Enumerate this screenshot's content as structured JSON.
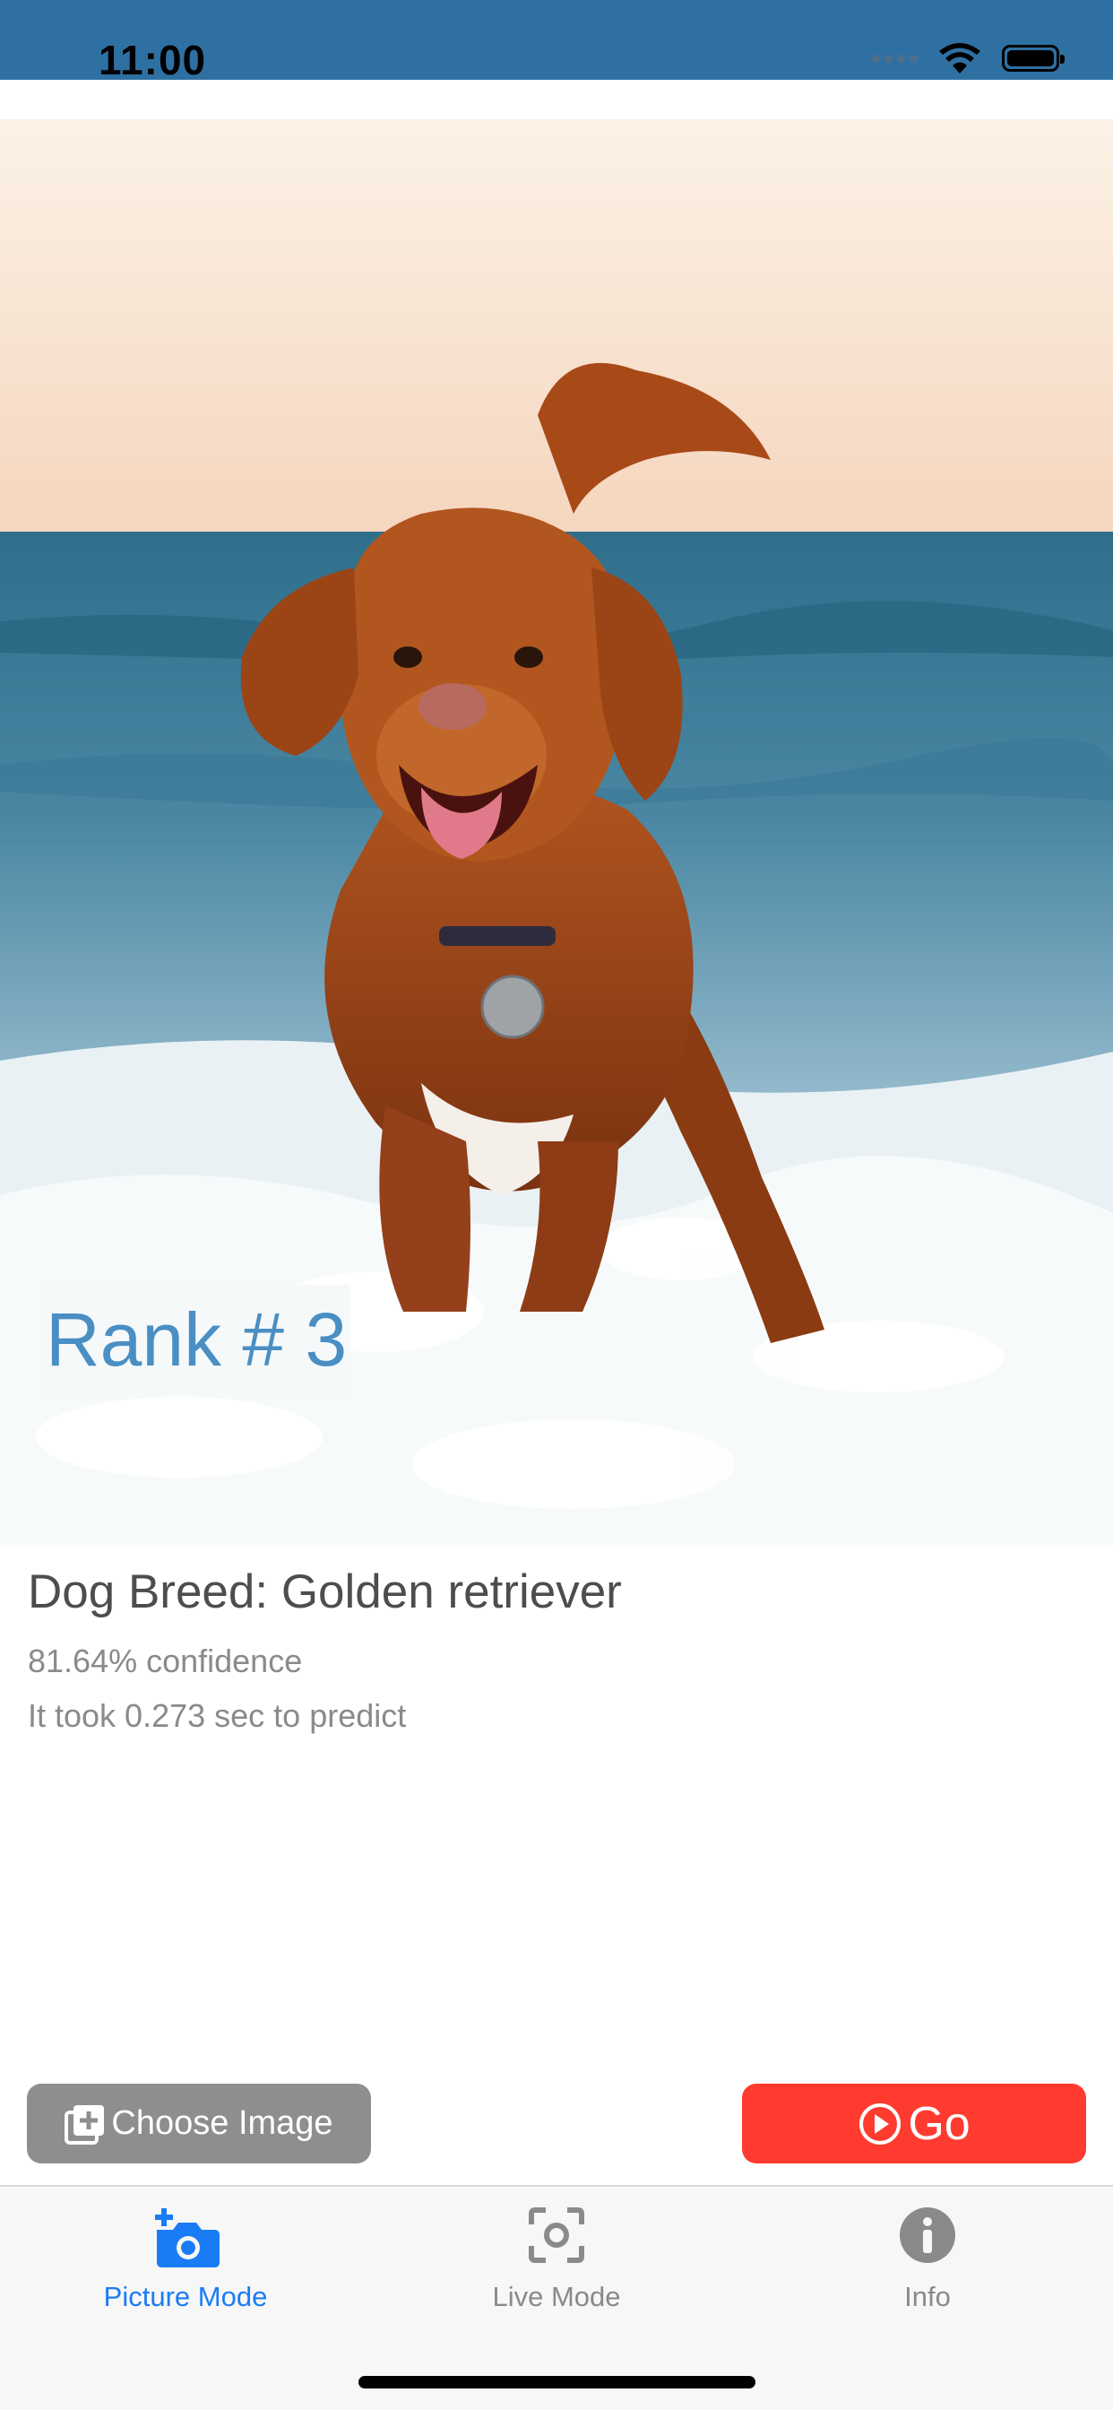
{
  "status_bar": {
    "time": "11:00",
    "icons": [
      "signal-icon",
      "wifi-icon",
      "battery-icon"
    ]
  },
  "photo": {
    "rank_label": "Rank # 3"
  },
  "result": {
    "breed": "Dog Breed: Golden retriever",
    "confidence": "81.64% confidence",
    "timing": "It took 0.273 sec to predict"
  },
  "buttons": {
    "choose_label": "Choose Image",
    "choose_icon": "add-photo-icon",
    "go_label": "Go",
    "go_icon": "play-circle-icon"
  },
  "tabs": [
    {
      "label": "Picture Mode",
      "icon": "camera-add-icon",
      "selected": true
    },
    {
      "label": "Live Mode",
      "icon": "viewfinder-icon",
      "selected": false
    },
    {
      "label": "Info",
      "icon": "info-icon",
      "selected": false
    }
  ],
  "colors": {
    "status_bar": "#2f70a2",
    "accent_blue": "#1a7cf5",
    "go_red": "#ff3b30",
    "choose_gray": "#8e8e8e",
    "rank_text": "#4a8fc3"
  }
}
